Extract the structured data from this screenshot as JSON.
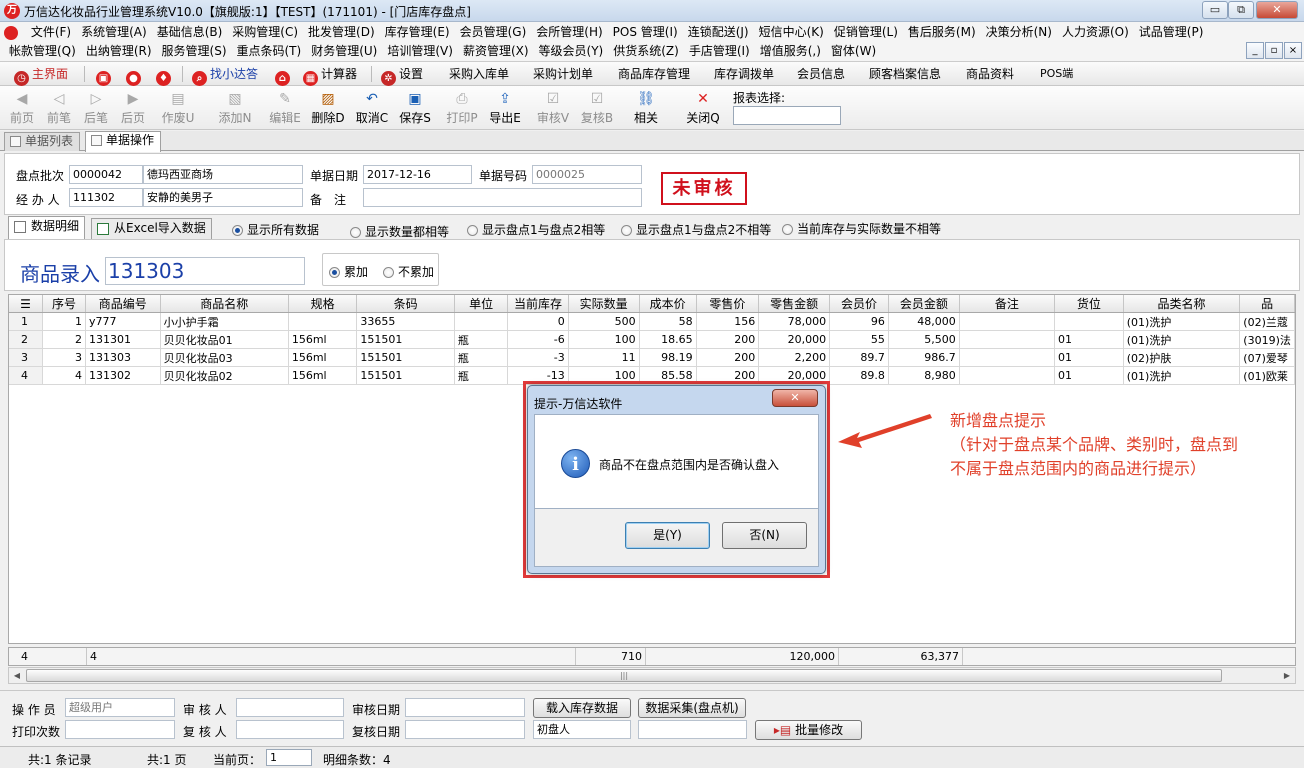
{
  "window": {
    "title": "万信达化妆品行业管理系统V10.0【旗舰版:1】【TEST】(171101) - [门店库存盘点]",
    "min": "▭",
    "max": "⧉",
    "close": "✕"
  },
  "menu": {
    "row1": [
      "文件(F)",
      "系统管理(A)",
      "基础信息(B)",
      "采购管理(C)",
      "批发管理(D)",
      "库存管理(E)",
      "会员管理(G)",
      "会所管理(H)",
      "POS 管理(I)",
      "连锁配送(J)",
      "短信中心(K)",
      "促销管理(L)",
      "售后服务(M)",
      "决策分析(N)",
      "人力资源(O)",
      "试品管理(P)"
    ],
    "row2": [
      "帐款管理(Q)",
      "出纳管理(R)",
      "服务管理(S)",
      "重点条码(T)",
      "财务管理(U)",
      "培训管理(V)",
      "薪资管理(X)",
      "等级会员(Y)",
      "供货系统(Z)",
      "手店管理(I)",
      "增值服务(,)",
      "窗体(W)"
    ]
  },
  "quickbar": {
    "home": "主界面",
    "find": "找小达答",
    "calc": "计算器",
    "settings": "设置",
    "links": [
      "采购入库单",
      "采购计划单",
      "商品库存管理",
      "库存调拨单",
      "会员信息",
      "顾客档案信息",
      "商品资料",
      "POS端"
    ]
  },
  "toolbar": {
    "first": "前页",
    "prev": "前笔",
    "next": "后笔",
    "last": "后页",
    "void": "作废U",
    "add": "添加N",
    "edit": "编辑E",
    "delete": "删除D",
    "cancel": "取消C",
    "save": "保存S",
    "print": "打印P",
    "export": "导出E",
    "audit": "审核V",
    "reaudit": "复核B",
    "related": "相关",
    "close": "关闭Q",
    "report_label": "报表选择:"
  },
  "tabs": [
    "单据列表",
    "单据操作"
  ],
  "header": {
    "batch_label": "盘点批次",
    "batch_code": "0000042",
    "batch_store": "德玛西亚商场",
    "date_label": "单据日期",
    "date": "2017-12-16",
    "docno_label": "单据号码",
    "docno": "0000025",
    "handler_label": "经 办 人",
    "handler_code": "111302",
    "handler_name": "安静的美男子",
    "remark_label": "备　注",
    "remark": "",
    "status": "未审核"
  },
  "subtabs": [
    "数据明细",
    "从Excel导入数据"
  ],
  "filters": {
    "options": [
      "显示所有数据",
      "显示数量都相等",
      "显示盘点1与盘点2相等",
      "显示盘点1与盘点2不相等",
      "当前库存与实际数量不相等"
    ],
    "selected": "显示所有数据"
  },
  "entry": {
    "label": "商品录入",
    "value": "131303",
    "accum": "累加",
    "noaccum": "不累加",
    "accum_selected": "累加"
  },
  "grid": {
    "columns": [
      "序号",
      "商品编号",
      "商品名称",
      "规格",
      "条码",
      "单位",
      "当前库存",
      "实际数量",
      "成本价",
      "零售价",
      "零售金额",
      "会员价",
      "会员金额",
      "备注",
      "货位",
      "品类名称",
      "品"
    ],
    "rows": [
      {
        "rn": "1",
        "cells": [
          "1",
          "y777",
          "小小护手霜",
          "",
          "33655",
          "",
          "0",
          "500",
          "58",
          "156",
          "78,000",
          "96",
          "48,000",
          "",
          "",
          "(01)洗护",
          "(02)兰蔻"
        ]
      },
      {
        "rn": "2",
        "cells": [
          "2",
          "131301",
          "贝贝化妆品01",
          "156ml",
          "151501",
          "瓶",
          "-6",
          "100",
          "18.65",
          "200",
          "20,000",
          "55",
          "5,500",
          "",
          "01",
          "(01)洗护",
          "(3019)法"
        ]
      },
      {
        "rn": "3",
        "cells": [
          "3",
          "131303",
          "贝贝化妆品03",
          "156ml",
          "151501",
          "瓶",
          "-3",
          "11",
          "98.19",
          "200",
          "2,200",
          "89.7",
          "986.7",
          "",
          "01",
          "(02)护肤",
          "(07)爱琴"
        ]
      },
      {
        "rn": "4",
        "cells": [
          "4",
          "131302",
          "贝贝化妆品02",
          "156ml",
          "151501",
          "瓶",
          "-13",
          "100",
          "85.58",
          "200",
          "20,000",
          "89.8",
          "8,980",
          "",
          "01",
          "(01)洗护",
          "(01)欧莱"
        ]
      }
    ]
  },
  "totals": {
    "rows": "4",
    "count": "4",
    "qty": "710",
    "retail": "120,000",
    "member": "63,377"
  },
  "bottom": {
    "operator_label": "操 作 员",
    "operator": "超级用户",
    "auditor_label": "审 核 人",
    "auditor": "",
    "audit_date_label": "审核日期",
    "audit_date": "",
    "print_count_label": "打印次数",
    "print_count": "",
    "reviewer_label": "复 核 人",
    "reviewer": "",
    "review_date_label": "复核日期",
    "review_date": "",
    "load_stock_btn": "载入库存数据",
    "collect_btn": "数据采集(盘点机)",
    "first_counter": "初盘人",
    "batch_edit_btn": "批量修改"
  },
  "status": {
    "records": "共:1 条记录",
    "pages": "共:1 页",
    "cur_page_label": "当前页：",
    "cur_page": "1",
    "detail_count": "明细条数：4"
  },
  "dialog": {
    "title": "提示-万信达软件",
    "close": "✕",
    "message": "商品不在盘点范围内是否确认盘入",
    "yes": "是(Y)",
    "no": "否(N)"
  },
  "annotation": {
    "line1": "新增盘点提示",
    "line2": "（针对于盘点某个品牌、类别时，盘点到",
    "line3": "不属于盘点范围内的商品进行提示）"
  },
  "colors": {
    "annotation": "#e0402a",
    "stamp": "#d0101c",
    "entry": "#1a3fa8"
  }
}
